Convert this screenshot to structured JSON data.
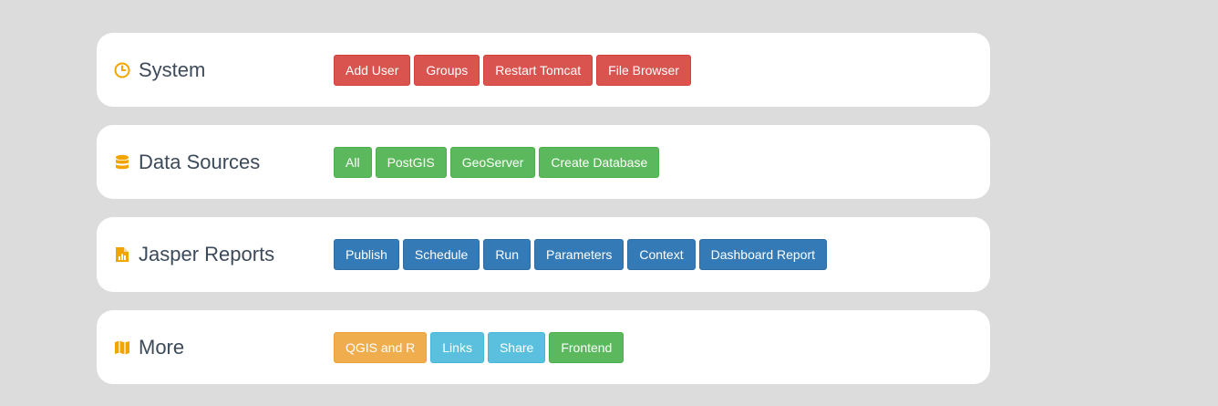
{
  "accent_icon_color": "#f0a500",
  "panels": [
    {
      "title": "System",
      "icon": "clock-icon",
      "buttons": [
        {
          "label": "Add User",
          "style": "danger"
        },
        {
          "label": "Groups",
          "style": "danger"
        },
        {
          "label": "Restart Tomcat",
          "style": "danger"
        },
        {
          "label": "File Browser",
          "style": "danger"
        }
      ]
    },
    {
      "title": "Data Sources",
      "icon": "database-icon",
      "buttons": [
        {
          "label": "All",
          "style": "success"
        },
        {
          "label": "PostGIS",
          "style": "success"
        },
        {
          "label": "GeoServer",
          "style": "success"
        },
        {
          "label": "Create Database",
          "style": "success"
        }
      ]
    },
    {
      "title": "Jasper Reports",
      "icon": "report-file-icon",
      "buttons": [
        {
          "label": "Publish",
          "style": "primary"
        },
        {
          "label": "Schedule",
          "style": "primary"
        },
        {
          "label": "Run",
          "style": "primary"
        },
        {
          "label": "Parameters",
          "style": "primary"
        },
        {
          "label": "Context",
          "style": "primary"
        },
        {
          "label": "Dashboard Report",
          "style": "primary"
        }
      ]
    },
    {
      "title": "More",
      "icon": "map-icon",
      "buttons": [
        {
          "label": "QGIS and R",
          "style": "warning"
        },
        {
          "label": "Links",
          "style": "info"
        },
        {
          "label": "Share",
          "style": "info"
        },
        {
          "label": "Frontend",
          "style": "success"
        }
      ]
    }
  ]
}
